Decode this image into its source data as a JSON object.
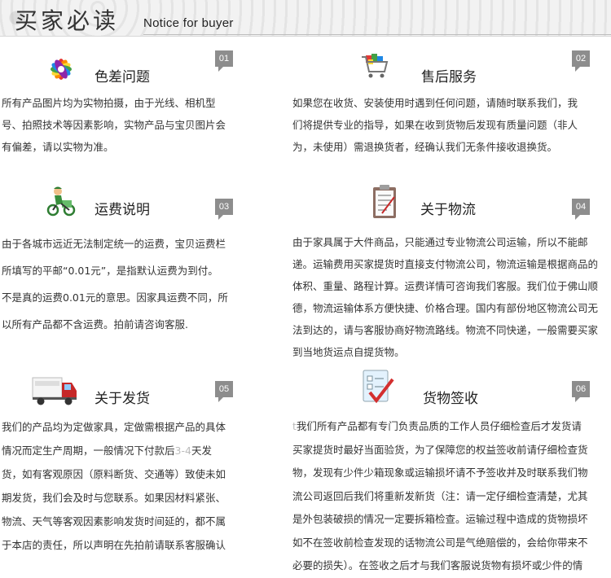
{
  "header": {
    "title_cn": "买家必读",
    "title_en": "Notice for buyer"
  },
  "sections": {
    "s01": {
      "title": "色差问题",
      "badge": "01",
      "icon": "color-flower-icon",
      "lines": [
        "所有产品图片均为实物拍摄，由于光线、相机型",
        "号、拍照技术等因素影响，实物产品与宝贝图片会",
        "有偏差，请以实物为准。"
      ]
    },
    "s02": {
      "title": "售后服务",
      "badge": "02",
      "icon": "shopping-cart-icon",
      "lines": [
        "如果您在收货、安装使用时遇到任何问题，请随时联系我们，我",
        "们将提供专业的指导，如果在收到货物后发现有质量问题（非人",
        "为，未使用）需退换货者，经确认我们无条件接收退换货。"
      ]
    },
    "s03": {
      "title": "运费说明",
      "badge": "03",
      "icon": "delivery-cyclist-icon",
      "lines": [
        "由于各城市远近无法制定统一的运费，宝贝运费栏",
        "所填写的平邮“0.01元”，是指默认运费为到付。",
        "不是真的运费0.01元的意思。因家具运费不同，所",
        "以所有产品都不含运费。拍前请咨询客服."
      ]
    },
    "s04": {
      "title": "关于物流",
      "badge": "04",
      "icon": "clipboard-icon",
      "lines": [
        "由于家具属于大件商品，只能通过专业物流公司运输，所以不能邮",
        "递。运输费用买家提货时直接支付物流公司，物流运输是根据商品的",
        "体积、重量、路程计算。运费详情可咨询我们客服。我们位于佛山顺",
        "德，物流运输体系方便快捷、价格合理。国内有部份地区物流公司无",
        "法到达的，请与客服协商好物流路线。物流不同快递，一般需要买家",
        "到当地货运点自提货物。"
      ]
    },
    "s05": {
      "title": "关于发货",
      "badge": "05",
      "icon": "truck-icon",
      "lines": [
        "我们的产品均为定做家具，定做需根据产品的具体",
        "情况而定生产周期，一般情况下付款后",
        "货，如有客观原因（原料断货、交通等）致使未如",
        "期发货，我们会及时与您联系。如果因材料紧张、",
        "物流、天气等客观因素影响发货时间延的，都不属",
        "于本店的责任，所以声明在先拍前请联系客服确认"
      ],
      "line2_muted": "3-4",
      "line2_tail": "天发"
    },
    "s06": {
      "title": "货物签收",
      "badge": "06",
      "icon": "checklist-icon",
      "lines": [
        "我们所有产品都有专门负责品质的工作人员仔细检查后才发货请",
        "买家提货时最好当面验货，为了保障您的权益签收前请仔细检查货",
        "物，发现有少件少箱现象或运输损坏请不予签收并及时联系我们物",
        "流公司返回后我们将重新发新货（注：请一定仔细检查清楚，尤其",
        "是外包装破损的情况一定要拆箱检查。运输过程中造成的货物损坏",
        "如不在签收前检查发现的话物流公司是气绝赔偿的，会给你带来不",
        "必要的损失）。在签收之后才与我们客服说货物有损坏或少件的情"
      ],
      "line1_prefix": "t"
    }
  }
}
